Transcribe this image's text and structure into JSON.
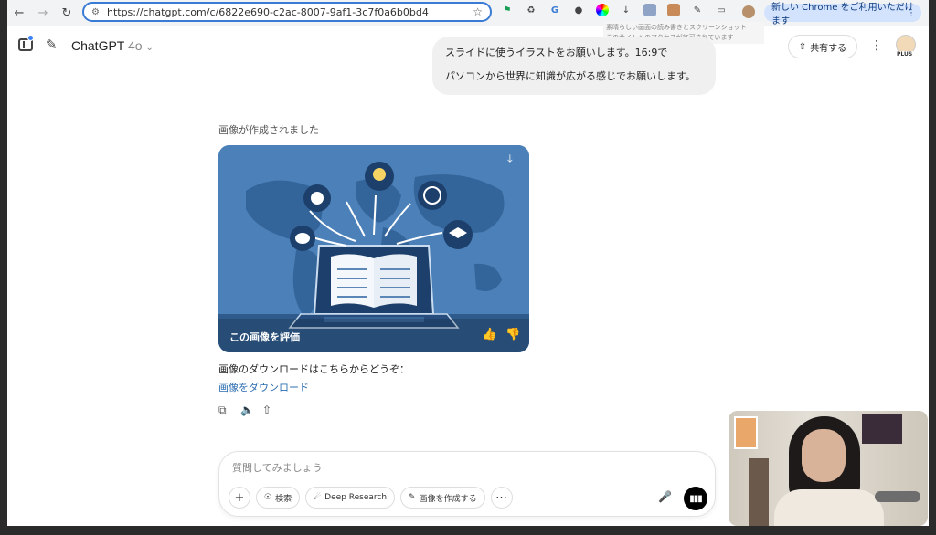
{
  "browser": {
    "url": "https://chatgpt.com/c/6822e690-c2ac-8007-9af1-3c7f0a6b0bd4",
    "extension_tooltip_line1": "素晴らしい画面の読み書きとスクリーンショット",
    "extension_tooltip_line2": "このサイトへのアクセスが許可されています",
    "chrome_notice": "新しい Chrome をご利用いただけます"
  },
  "header": {
    "model_name": "ChatGPT",
    "model_version": "4o",
    "share_label": "共有する",
    "plan_badge": "PLUS"
  },
  "conversation": {
    "user_message": {
      "line1": "スライドに使うイラストをお願いします。16:9で",
      "line2": "パソコンから世界に知識が広がる感じでお願いします。"
    },
    "assistant": {
      "image_caption": "画像が作成されました",
      "rate_label": "この画像を評価",
      "download_text": "画像のダウンロードはこちらからどうぞ：",
      "download_link": "画像をダウンロード"
    }
  },
  "composer": {
    "placeholder": "質問してみましょう",
    "search_label": "検索",
    "deep_research_label": "Deep Research",
    "create_image_label": "画像を作成する"
  },
  "colors": {
    "accent_blue": "#3a7bd5",
    "link_blue": "#2b6cb0",
    "image_bg": "#4a7eb5",
    "voice_button": "#000000"
  }
}
